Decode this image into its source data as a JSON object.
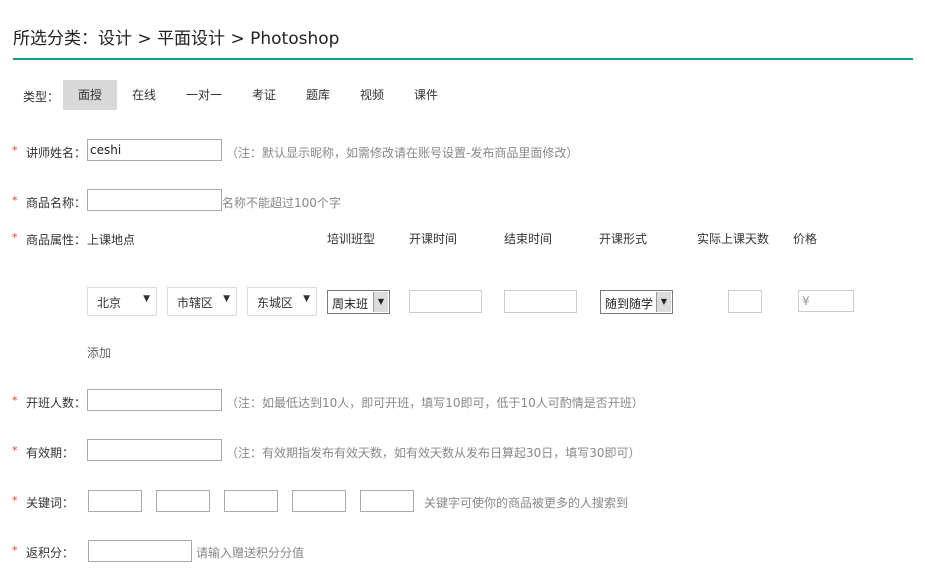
{
  "breadcrumb": "所选分类：设计 > 平面设计 > Photoshop",
  "type_label": "类型：",
  "tabs": [
    "面授",
    "在线",
    "一对一",
    "考证",
    "题库",
    "视频",
    "课件"
  ],
  "active_tab": "面授",
  "required_mark": "*",
  "teacher": {
    "label": "讲师姓名：",
    "value": "ceshi",
    "hint": "（注：默认显示昵称，如需修改请在账号设置-发布商品里面修改）"
  },
  "product_name": {
    "label": "商品名称：",
    "value": "",
    "hint": "名称不能超过100个字"
  },
  "attrs": {
    "label": "商品属性：",
    "columns": [
      "上课地点",
      "培训班型",
      "开课时间",
      "结束时间",
      "开课形式",
      "实际上课天数",
      "价格"
    ],
    "city": "北京",
    "district": "市辖区",
    "area": "东城区",
    "class_type": "周末班",
    "start_time": "",
    "end_time": "",
    "form": "随到随学",
    "days": "",
    "price_prefix": "¥",
    "add_label": "添加"
  },
  "open_count": {
    "label": "开班人数：",
    "value": "",
    "hint": "（注：如最低达到10人，即可开班，填写10即可，低于10人可酌情是否开班）"
  },
  "validity": {
    "label": "有效期：",
    "value": "",
    "hint": "（注：有效期指发布有效天数，如有效天数从发布日算起30日，填写30即可）"
  },
  "keywords": {
    "label": "关键词：",
    "values": [
      "",
      "",
      "",
      "",
      ""
    ],
    "hint": "关键字可使你的商品被更多的人搜索到"
  },
  "points": {
    "label": "返积分：",
    "value": "",
    "hint": "请输入赠送积分分值"
  },
  "colors": {
    "accent_rule": "#1a9a8a",
    "required": "#ff3333",
    "active_tab_bg": "#d9d9d9"
  }
}
